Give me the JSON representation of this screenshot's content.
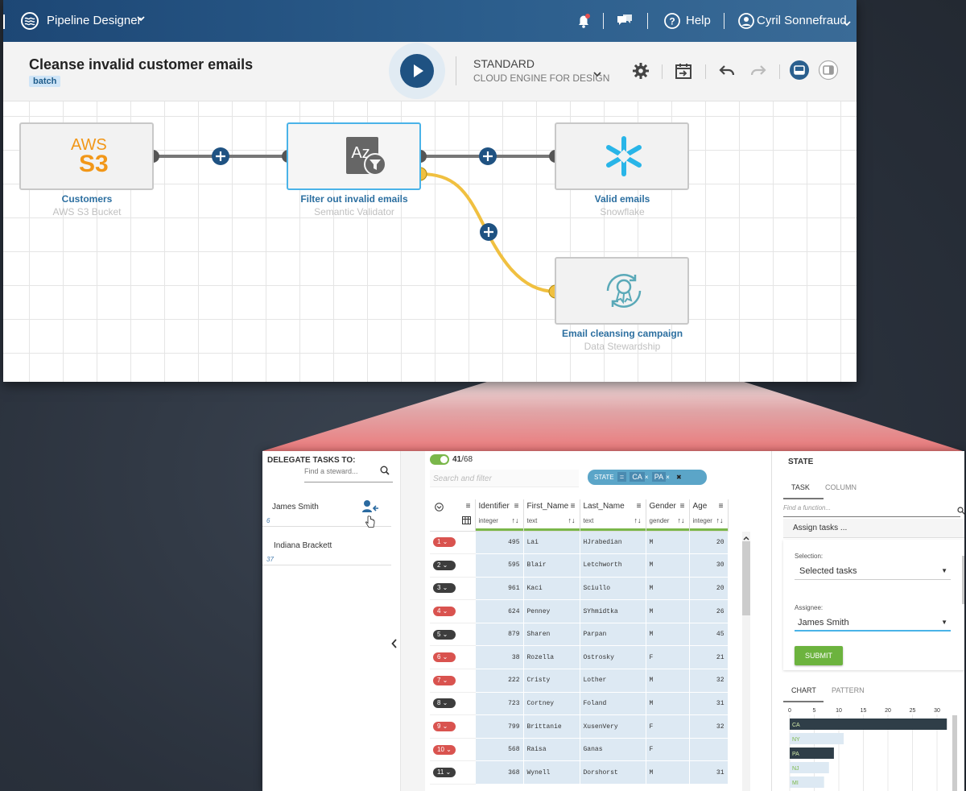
{
  "topbar": {
    "app_name": "Pipeline Designer",
    "help": "Help",
    "user": "Cyril Sonnefraud"
  },
  "toolbar": {
    "pipeline_title": "Cleanse invalid customer emails",
    "badge": "batch",
    "engine_name": "STANDARD",
    "engine_sub": "CLOUD ENGINE FOR DESIGN"
  },
  "nodes": [
    {
      "label": "Customers",
      "sub": "AWS S3 Bucket",
      "logo_top": "AWS",
      "logo_bottom": "S3"
    },
    {
      "label": "Filter out invalid emails",
      "sub": "Semantic Validator",
      "logo_top": "Az"
    },
    {
      "label": "Valid emails",
      "sub": "Snowflake"
    },
    {
      "label": "Email cleansing campaign",
      "sub": "Data Stewardship"
    }
  ],
  "delegate": {
    "title": "DELEGATE TASKS TO:",
    "search_placeholder": "Find a steward...",
    "stewards": [
      {
        "name": "James Smith",
        "count": "6"
      },
      {
        "name": "Indiana Brackett",
        "count": "37"
      }
    ]
  },
  "grid": {
    "shown": "41",
    "total": "/68",
    "search_placeholder": "Search and filter",
    "chip": {
      "label": "STATE",
      "op": "=",
      "values": [
        "CA",
        "PA"
      ]
    },
    "columns": [
      {
        "name": "Identifier",
        "type": "integer"
      },
      {
        "name": "First_Name",
        "type": "text"
      },
      {
        "name": "Last_Name",
        "type": "text"
      },
      {
        "name": "Gender",
        "type": "gender"
      },
      {
        "name": "Age",
        "type": "integer"
      }
    ],
    "rows": [
      {
        "n": "1",
        "c": "red",
        "id": "495",
        "first": "Lai",
        "last": "HJrabedian",
        "g": "M",
        "age": "20"
      },
      {
        "n": "2",
        "c": "dark",
        "id": "595",
        "first": "Blair",
        "last": "Letchworth",
        "g": "M",
        "age": "30"
      },
      {
        "n": "3",
        "c": "dark",
        "id": "961",
        "first": "Kaci",
        "last": "Sciullo",
        "g": "M",
        "age": "20"
      },
      {
        "n": "4",
        "c": "red",
        "id": "624",
        "first": "Penney",
        "last": "SYhmidtka",
        "g": "M",
        "age": "26"
      },
      {
        "n": "5",
        "c": "dark",
        "id": "879",
        "first": "Sharen",
        "last": "Parpan",
        "g": "M",
        "age": "45"
      },
      {
        "n": "6",
        "c": "red",
        "id": "38",
        "first": "Rozella",
        "last": "Ostrosky",
        "g": "F",
        "age": "21"
      },
      {
        "n": "7",
        "c": "red",
        "id": "222",
        "first": "Cristy",
        "last": "Lother",
        "g": "M",
        "age": "32"
      },
      {
        "n": "8",
        "c": "dark",
        "id": "723",
        "first": "Cortney",
        "last": "Foland",
        "g": "M",
        "age": "31"
      },
      {
        "n": "9",
        "c": "red",
        "id": "799",
        "first": "Brittanie",
        "last": "XusenVery",
        "g": "F",
        "age": "32"
      },
      {
        "n": "10",
        "c": "red",
        "id": "568",
        "first": "Raisa",
        "last": "Ganas",
        "g": "F",
        "age": ""
      },
      {
        "n": "11",
        "c": "dark",
        "id": "368",
        "first": "Wynell",
        "last": "Dorshorst",
        "g": "M",
        "age": "31"
      }
    ]
  },
  "panel": {
    "title": "STATE",
    "tab_task": "TASK",
    "tab_column": "COLUMN",
    "fn_placeholder": "Find a function...",
    "assign": "Assign tasks ...",
    "selection_label": "Selection:",
    "selection_value": "Selected tasks",
    "assignee_label": "Assignee:",
    "assignee_value": "James Smith",
    "submit": "SUBMIT",
    "tab_chart": "CHART",
    "tab_pattern": "PATTERN"
  },
  "colors": {
    "brand": "#1f5282",
    "accent": "#4ab3e8",
    "submit": "#6cb33e",
    "bar_dark": "#2f3e48",
    "bar_light": "#dde9f3",
    "reject_link": "#f0c040"
  },
  "chart_data": {
    "type": "bar",
    "orientation": "horizontal",
    "ticks": [
      0,
      5,
      10,
      15,
      20,
      25,
      30
    ],
    "categories": [
      "CA",
      "NY",
      "PA",
      "NJ",
      "MI"
    ],
    "values": [
      32,
      11,
      9,
      8,
      7
    ],
    "selected": [
      "CA",
      "PA"
    ]
  }
}
